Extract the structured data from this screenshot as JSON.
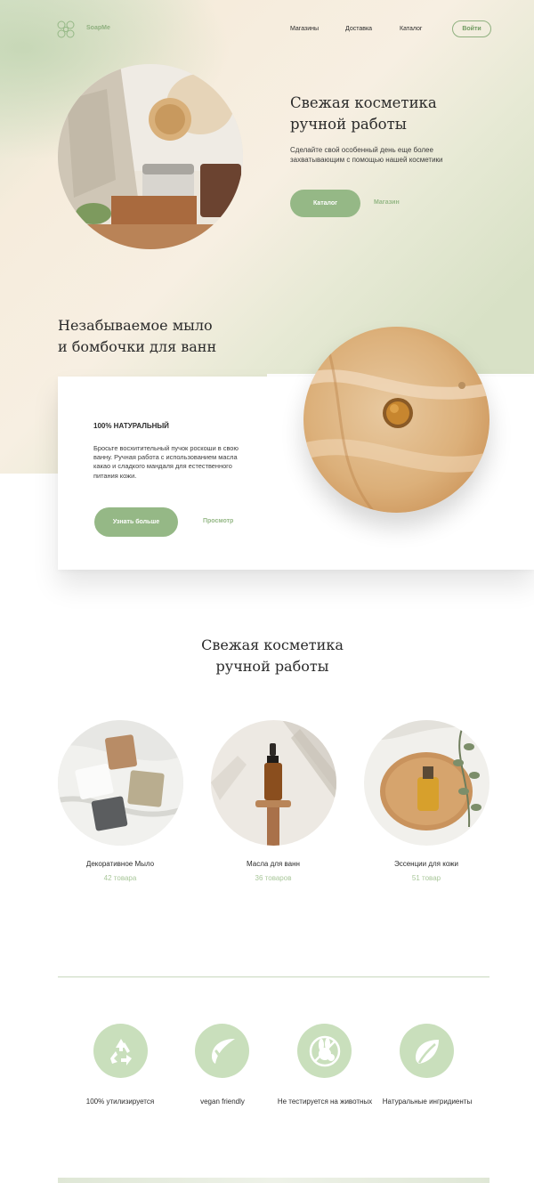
{
  "header": {
    "brand": "SoapMe",
    "nav": [
      "Магазины",
      "Доставка",
      "Каталог"
    ],
    "login": "Войти"
  },
  "hero": {
    "title_line1": "Свежая косметика",
    "title_line2": "ручной работы",
    "subtitle": "Сделайте свой особенный день еще более захватывающим с помощью нашей косметики",
    "primary_button": "Каталог",
    "secondary_link": "Магазин"
  },
  "soap": {
    "title_line1": "Незабываемое мыло",
    "title_line2": "и бомбочки для ванн",
    "heading": "100% НАТУРАЛЬНЫЙ",
    "text": "Бросьте восхитительный пучок роскоши в свою ванну. Ручная работа с использованием масла какао и сладкого мандаля для естественного питания кожи.",
    "primary_button": "Узнать больше",
    "secondary_link": "Просмотр"
  },
  "categories": {
    "title_line1": "Свежая косметика",
    "title_line2": "ручной работы",
    "items": [
      {
        "name": "Декоративное Мыло",
        "count": "42 товара"
      },
      {
        "name": "Масла для ванн",
        "count": "36 товаров"
      },
      {
        "name": "Эссенции для кожи",
        "count": "51 товар"
      }
    ]
  },
  "features": [
    {
      "label": "100% утилизируется",
      "icon": "recycle-icon"
    },
    {
      "label": "vegan friendly",
      "icon": "leaf-check-icon"
    },
    {
      "label": "Не тестируется на животных",
      "icon": "rabbit-icon"
    },
    {
      "label": "Натуральные ингридиенты",
      "icon": "leaf-icon"
    }
  ],
  "colors": {
    "accent": "#95b886",
    "feature_circle": "#c9dfbc",
    "count_text": "#a9c79a"
  }
}
